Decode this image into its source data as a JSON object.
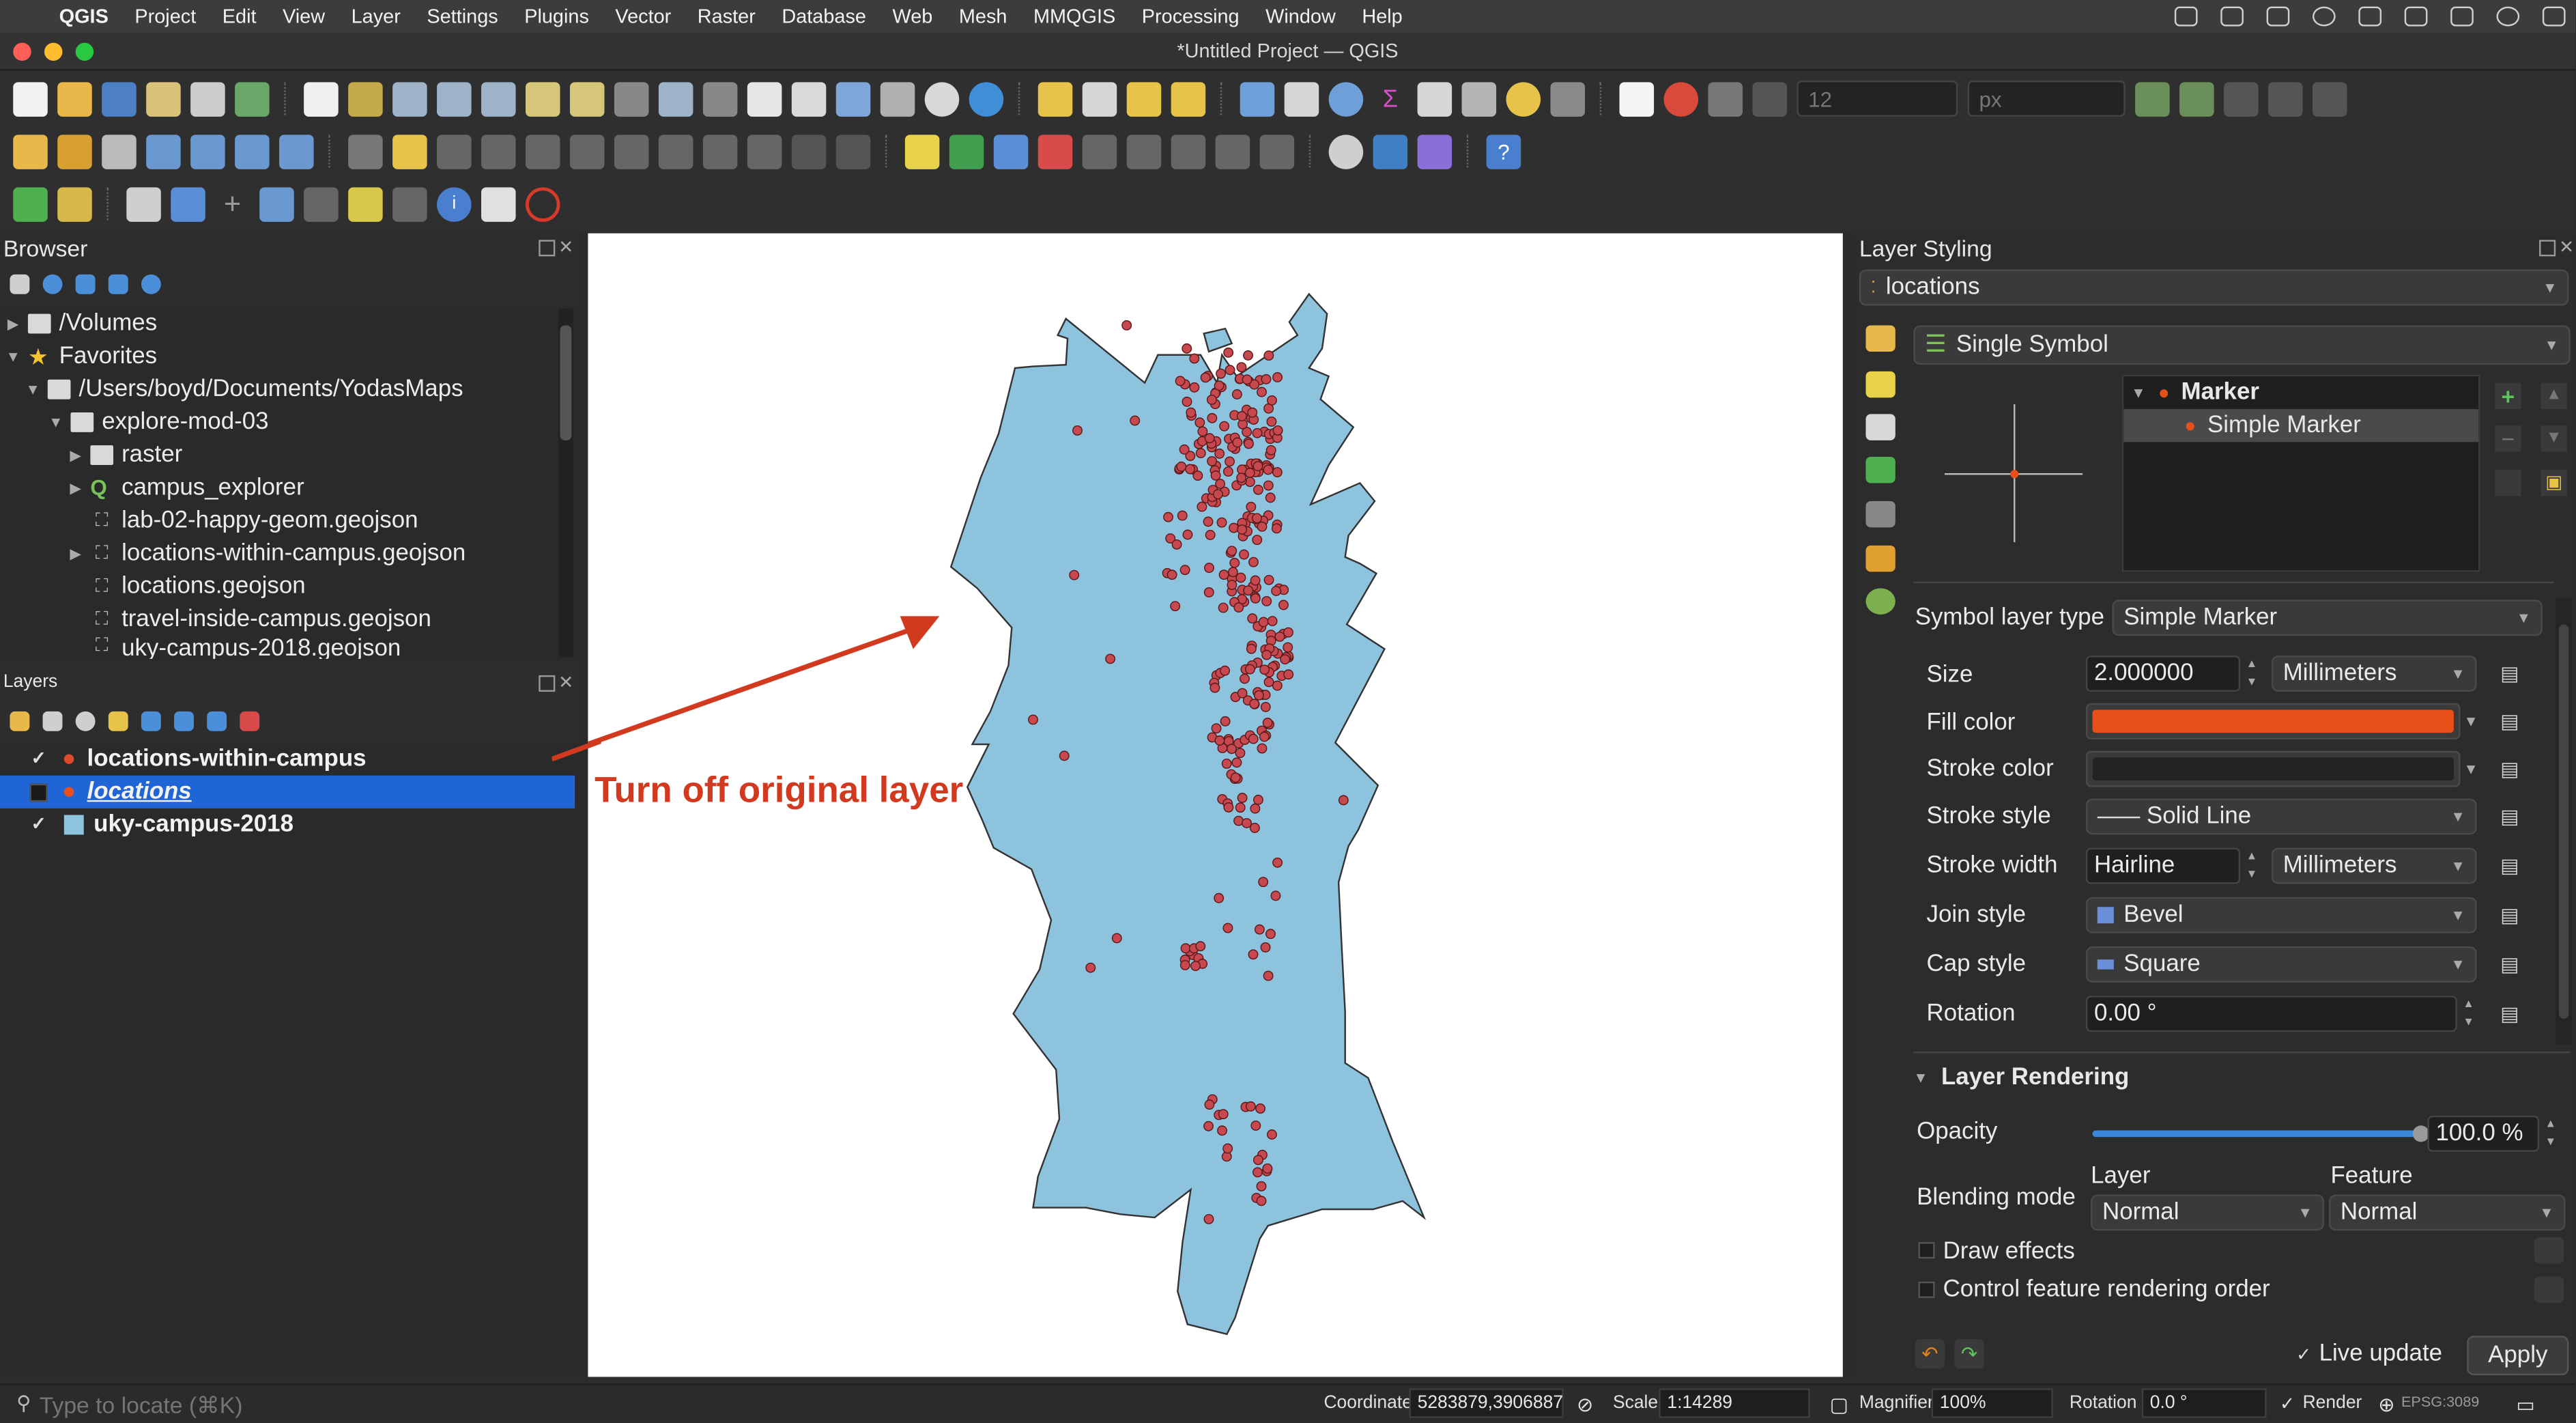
{
  "menubar": {
    "app": "QGIS",
    "items": [
      "Project",
      "Edit",
      "View",
      "Layer",
      "Settings",
      "Plugins",
      "Vector",
      "Raster",
      "Database",
      "Web",
      "Mesh",
      "MMQGIS",
      "Processing",
      "Window",
      "Help"
    ]
  },
  "window": {
    "title": "*Untitled Project — QGIS"
  },
  "toolbar": {
    "snap_tolerance": "12",
    "snap_unit": "px"
  },
  "browser": {
    "title": "Browser",
    "items": [
      "/Volumes",
      "Favorites",
      "/Users/boyd/Documents/YodasMaps",
      "explore-mod-03",
      "raster",
      "campus_explorer",
      "lab-02-happy-geom.geojson",
      "locations-within-campus.geojson",
      "locations.geojson",
      "travel-inside-campus.geojson",
      "uky-campus-2018.geojson"
    ]
  },
  "layers": {
    "title": "Layers",
    "items": [
      {
        "name": "locations-within-campus",
        "checked": true,
        "selected": false
      },
      {
        "name": "locations",
        "checked": false,
        "selected": true
      },
      {
        "name": "uky-campus-2018",
        "checked": true,
        "selected": false
      }
    ]
  },
  "annotation": {
    "text": "Turn off original  layer",
    "color": "#d13a1f"
  },
  "map": {
    "polygon_fill": "#8ec3dd",
    "point_fill": "#c7484f",
    "background": "#ffffff"
  },
  "styling": {
    "title": "Layer Styling",
    "layer": "locations",
    "renderer": "Single Symbol",
    "tree_marker": "Marker",
    "tree_simple_marker": "Simple Marker",
    "symbol_layer_type_label": "Symbol layer type",
    "symbol_layer_type": "Simple Marker",
    "props": [
      {
        "label": "Size",
        "value": "2.000000",
        "unit": "Millimeters"
      },
      {
        "label": "Fill color",
        "value": ""
      },
      {
        "label": "Stroke color",
        "value": ""
      },
      {
        "label": "Stroke style",
        "value": "Solid Line"
      },
      {
        "label": "Stroke width",
        "value": "Hairline",
        "unit": "Millimeters"
      },
      {
        "label": "Join style",
        "value": "Bevel"
      },
      {
        "label": "Cap style",
        "value": "Square"
      },
      {
        "label": "Rotation",
        "value": "0.00 °"
      }
    ],
    "fill_color": "#e8501a",
    "stroke_color": "#232323",
    "layer_rendering": "Layer Rendering",
    "opacity_label": "Opacity",
    "opacity_value": "100.0 %",
    "opacity": 1.0,
    "blending_label": "Blending mode",
    "blend_layer_label": "Layer",
    "blend_feature_label": "Feature",
    "blend_layer": "Normal",
    "blend_feature": "Normal",
    "draw_effects": "Draw effects",
    "control_order": "Control feature rendering order",
    "live_update": "Live update",
    "apply": "Apply"
  },
  "statusbar": {
    "locate_placeholder": "Type to locate (⌘K)",
    "coordinate_label": "Coordinate",
    "coordinate": "5283879,3906887",
    "scale_label": "Scale",
    "scale": "1:14289",
    "magnifier_label": "Magnifier",
    "magnifier": "100%",
    "rotation_label": "Rotation",
    "rotation": "0.0 °",
    "render_label": "Render",
    "crs": "EPSG:3089"
  }
}
